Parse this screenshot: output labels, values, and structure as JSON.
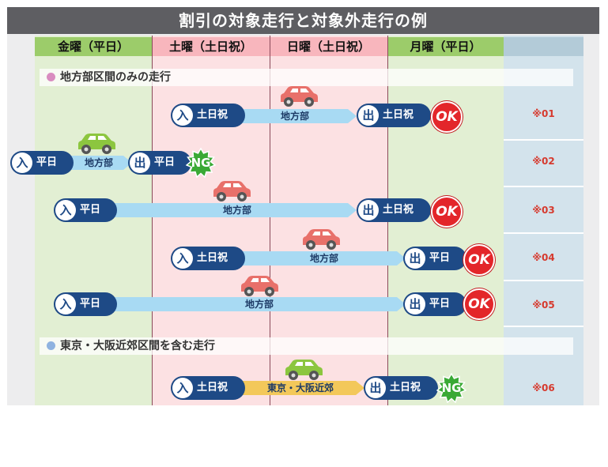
{
  "title": "割引の対象走行と対象外走行の例",
  "days": [
    "金曜（平日）",
    "土曜（土日祝）",
    "日曜（土日祝）",
    "月曜（平日）"
  ],
  "sections": {
    "local": "地方部区間のみの走行",
    "urban": "東京・大阪近郊区間を含む走行"
  },
  "labels": {
    "entry": "入",
    "exit": "出",
    "weekday": "平日",
    "holiday": "土日祝",
    "local_route": "地方部",
    "urban_route": "東京・大阪近郊",
    "ok": "OK",
    "ng": "NG"
  },
  "notes": [
    "※01",
    "※02",
    "※03",
    "※04",
    "※05",
    "※06"
  ],
  "colors": {
    "car_red": "#e8706a",
    "car_green": "#8cc63f",
    "ok": "#e3262a",
    "ng": "#3aa935",
    "pill": "#1e4a86"
  }
}
